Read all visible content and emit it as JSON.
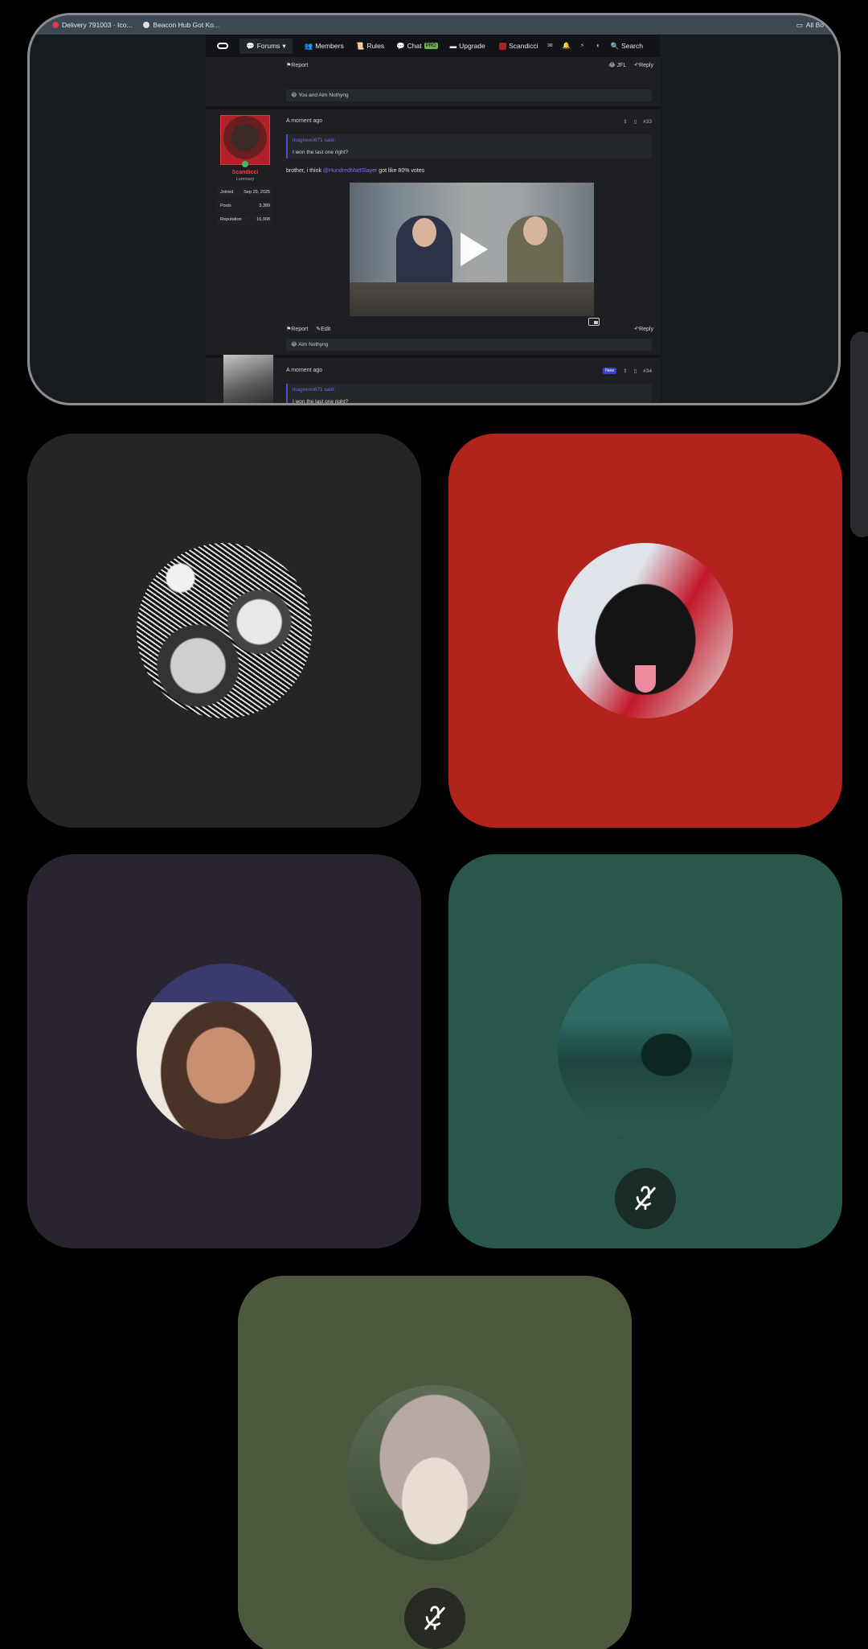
{
  "browser": {
    "bookmarks": [
      "Delivery 791003 · Ico...",
      "Beacon Hub Got Ko..."
    ],
    "all_bookmarks": "All Bo"
  },
  "forum": {
    "nav": {
      "forums": "Forums",
      "members": "Members",
      "rules": "Rules",
      "chat": "Chat",
      "chat_badge": "PRO",
      "upgrade": "Upgrade",
      "user": "Scandicci",
      "search": "Search"
    },
    "prev_post": {
      "report": "Report",
      "jfl": "JFL",
      "reply": "Reply",
      "reactions": "You and Aim Nothyng"
    },
    "post": {
      "time": "A moment ago",
      "number": "#33",
      "author": "Scandicci",
      "rank": "Luminary",
      "joined_label": "Joined",
      "joined": "Sep 29, 2025",
      "posts_label": "Posts",
      "posts": "3,389",
      "rep_label": "Reputation",
      "rep": "16,908",
      "quote_author": "magnevo671 said:",
      "quote_text": "I won the last one right?",
      "text_before": "brother, i think",
      "mention": "@HundredMattSlayer",
      "text_after": "got like 80% votes",
      "report": "Report",
      "edit": "Edit",
      "reply": "Reply",
      "reactions": "Aim Nothyng"
    },
    "next_post": {
      "time": "A moment ago",
      "badge": "New",
      "number": "#34",
      "quote_author": "magnevo671 said:",
      "quote_text": "I won the last one right?"
    }
  },
  "participants": [
    {
      "tile_color": "#252527",
      "muted": false
    },
    {
      "tile_color": "#b2241b",
      "muted": false
    },
    {
      "tile_color": "#29242f",
      "muted": false
    },
    {
      "tile_color": "#2a574b",
      "muted": true
    },
    {
      "tile_color": "#4d593f",
      "muted": true
    }
  ],
  "icons": {
    "mute": "mic-off-icon",
    "play": "play-icon"
  }
}
